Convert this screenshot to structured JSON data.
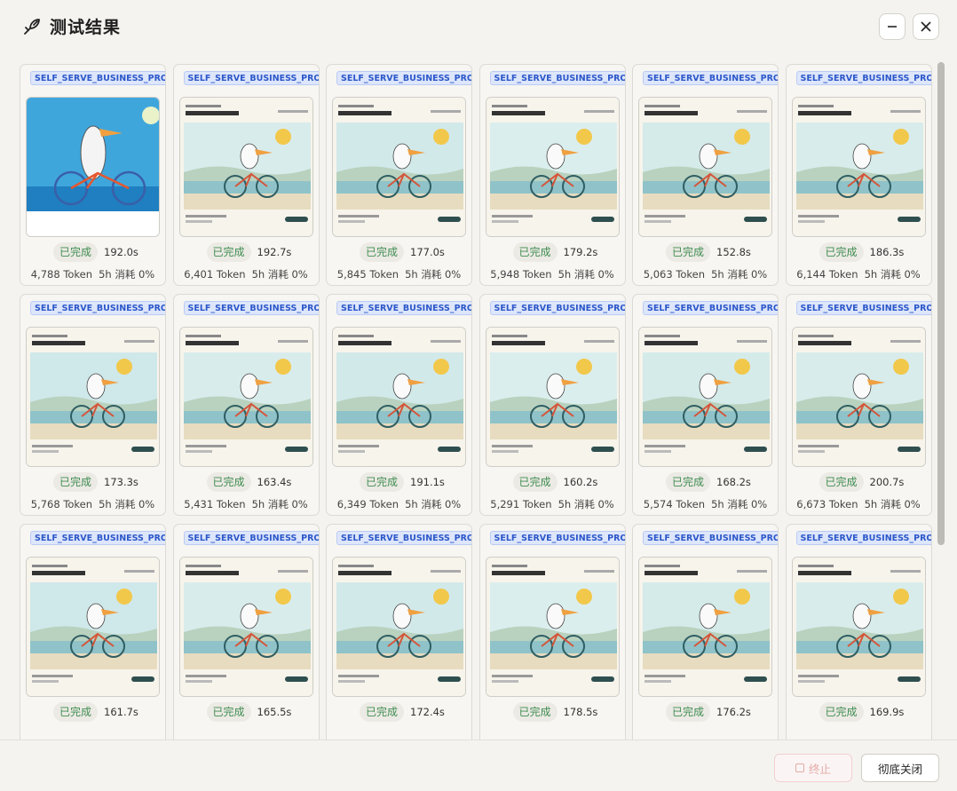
{
  "header": {
    "title": "测试结果",
    "icon": "pencil-bird-icon"
  },
  "cards": [
    {
      "tag": "SELF_SERVE_BUSINESS_PROLITE",
      "status": "已完成",
      "time": "192.0s",
      "tokens": "4,788 Token",
      "usage": "5h 消耗 0%",
      "thumb_variant": "full"
    },
    {
      "tag": "SELF_SERVE_BUSINESS_PROLITE",
      "status": "已完成",
      "time": "192.7s",
      "tokens": "6,401 Token",
      "usage": "5h 消耗 0%",
      "thumb_variant": "site"
    },
    {
      "tag": "SELF_SERVE_BUSINESS_PROLITE",
      "status": "已完成",
      "time": "177.0s",
      "tokens": "5,845 Token",
      "usage": "5h 消耗 0%",
      "thumb_variant": "site"
    },
    {
      "tag": "SELF_SERVE_BUSINESS_PROLITE",
      "status": "已完成",
      "time": "179.2s",
      "tokens": "5,948 Token",
      "usage": "5h 消耗 0%",
      "thumb_variant": "site"
    },
    {
      "tag": "SELF_SERVE_BUSINESS_PROLITE",
      "status": "已完成",
      "time": "152.8s",
      "tokens": "5,063 Token",
      "usage": "5h 消耗 0%",
      "thumb_variant": "site"
    },
    {
      "tag": "SELF_SERVE_BUSINESS_PROLITE",
      "status": "已完成",
      "time": "186.3s",
      "tokens": "6,144 Token",
      "usage": "5h 消耗 0%",
      "thumb_variant": "site"
    },
    {
      "tag": "SELF_SERVE_BUSINESS_PROLITE",
      "status": "已完成",
      "time": "173.3s",
      "tokens": "5,768 Token",
      "usage": "5h 消耗 0%",
      "thumb_variant": "site"
    },
    {
      "tag": "SELF_SERVE_BUSINESS_PROLITE",
      "status": "已完成",
      "time": "163.4s",
      "tokens": "5,431 Token",
      "usage": "5h 消耗 0%",
      "thumb_variant": "site"
    },
    {
      "tag": "SELF_SERVE_BUSINESS_PROLITE",
      "status": "已完成",
      "time": "191.1s",
      "tokens": "6,349 Token",
      "usage": "5h 消耗 0%",
      "thumb_variant": "site"
    },
    {
      "tag": "SELF_SERVE_BUSINESS_PROLITE",
      "status": "已完成",
      "time": "160.2s",
      "tokens": "5,291 Token",
      "usage": "5h 消耗 0%",
      "thumb_variant": "site"
    },
    {
      "tag": "SELF_SERVE_BUSINESS_PROLITE",
      "status": "已完成",
      "time": "168.2s",
      "tokens": "5,574 Token",
      "usage": "5h 消耗 0%",
      "thumb_variant": "site"
    },
    {
      "tag": "SELF_SERVE_BUSINESS_PROLITE",
      "status": "已完成",
      "time": "200.7s",
      "tokens": "6,673 Token",
      "usage": "5h 消耗 0%",
      "thumb_variant": "site"
    },
    {
      "tag": "SELF_SERVE_BUSINESS_PROLITE",
      "status": "已完成",
      "time": "161.7s",
      "tokens": "",
      "usage": "",
      "thumb_variant": "site"
    },
    {
      "tag": "SELF_SERVE_BUSINESS_PROLITE",
      "status": "已完成",
      "time": "165.5s",
      "tokens": "",
      "usage": "",
      "thumb_variant": "site"
    },
    {
      "tag": "SELF_SERVE_BUSINESS_PROLITE",
      "status": "已完成",
      "time": "172.4s",
      "tokens": "",
      "usage": "",
      "thumb_variant": "site"
    },
    {
      "tag": "SELF_SERVE_BUSINESS_PROLITE",
      "status": "已完成",
      "time": "178.5s",
      "tokens": "",
      "usage": "",
      "thumb_variant": "site"
    },
    {
      "tag": "SELF_SERVE_BUSINESS_PROLITE",
      "status": "已完成",
      "time": "176.2s",
      "tokens": "",
      "usage": "",
      "thumb_variant": "site"
    },
    {
      "tag": "SELF_SERVE_BUSINESS_PROLITE",
      "status": "已完成",
      "time": "169.9s",
      "tokens": "",
      "usage": "",
      "thumb_variant": "site"
    }
  ],
  "footer": {
    "stop_label": "终止",
    "close_all_label": "彻底关闭"
  },
  "colors": {
    "tag_text": "#2c57c9",
    "tag_bg": "#dde6fb",
    "status_text": "#3f8d52",
    "stop_text": "#e5a9a7"
  }
}
